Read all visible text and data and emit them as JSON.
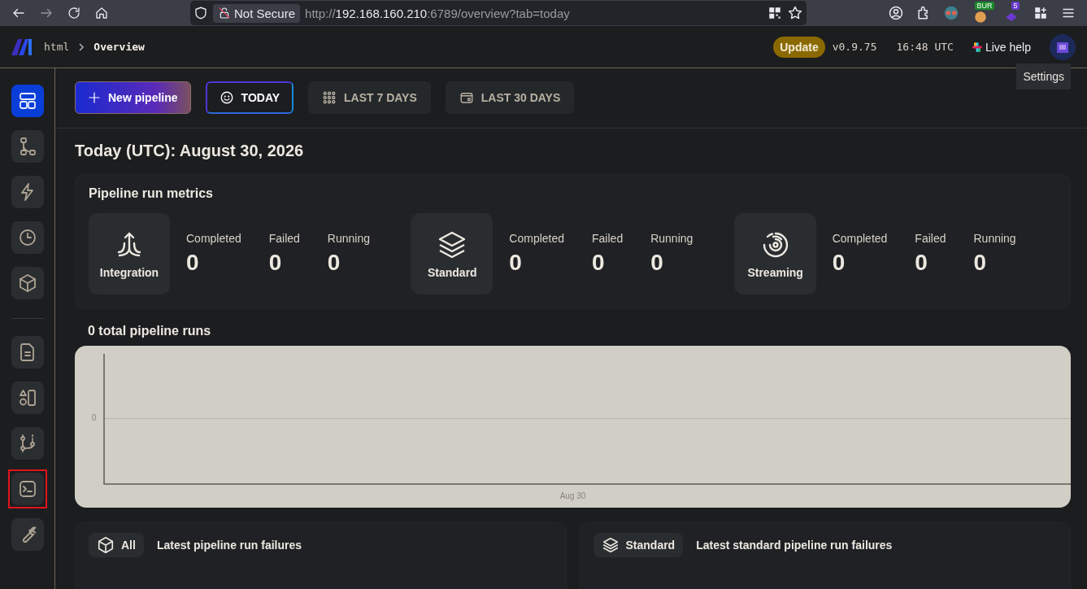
{
  "browser": {
    "security_label": "Not Secure",
    "url_scheme": "http://",
    "url_host": "192.168.160.210",
    "url_path": ":6789/overview?tab=today",
    "extension_badges": [
      "BUR",
      "5"
    ]
  },
  "header": {
    "breadcrumb": [
      "html",
      "Overview"
    ],
    "update_button": "Update",
    "version": "v0.9.75",
    "time": "16:48 UTC",
    "live_help": "Live help",
    "tooltip": "Settings"
  },
  "sidebar": {
    "top_items": [
      {
        "selected": true,
        "highlighted": false
      },
      {
        "selected": false,
        "highlighted": false
      },
      {
        "selected": false,
        "highlighted": false
      },
      {
        "selected": false,
        "highlighted": false
      },
      {
        "selected": false,
        "highlighted": false
      }
    ],
    "bottom_items": [
      {
        "selected": false,
        "highlighted": false
      },
      {
        "selected": false,
        "highlighted": false
      },
      {
        "selected": false,
        "highlighted": false
      },
      {
        "selected": false,
        "highlighted": true
      },
      {
        "selected": false,
        "highlighted": false
      }
    ]
  },
  "toolbar": {
    "new_pipeline": "New pipeline",
    "tabs": [
      {
        "label": "TODAY",
        "selected": true
      },
      {
        "label": "LAST 7 DAYS",
        "selected": false
      },
      {
        "label": "LAST 30 DAYS",
        "selected": false
      }
    ]
  },
  "heading": "Today (UTC): August 30, 2026",
  "metrics": {
    "title": "Pipeline run metrics",
    "groups": [
      {
        "name": "Integration",
        "stats": [
          {
            "label": "Completed",
            "value": "0"
          },
          {
            "label": "Failed",
            "value": "0"
          },
          {
            "label": "Running",
            "value": "0"
          }
        ]
      },
      {
        "name": "Standard",
        "stats": [
          {
            "label": "Completed",
            "value": "0"
          },
          {
            "label": "Failed",
            "value": "0"
          },
          {
            "label": "Running",
            "value": "0"
          }
        ]
      },
      {
        "name": "Streaming",
        "stats": [
          {
            "label": "Completed",
            "value": "0"
          },
          {
            "label": "Failed",
            "value": "0"
          },
          {
            "label": "Running",
            "value": "0"
          }
        ]
      }
    ]
  },
  "runs_chart": {
    "title": "0 total pipeline runs",
    "y_tick": "0",
    "x_label": "Aug 30"
  },
  "failure_panels": [
    {
      "tag": "All",
      "title": "Latest pipeline run failures"
    },
    {
      "tag": "Standard",
      "title": "Latest standard pipeline run failures"
    }
  ]
}
